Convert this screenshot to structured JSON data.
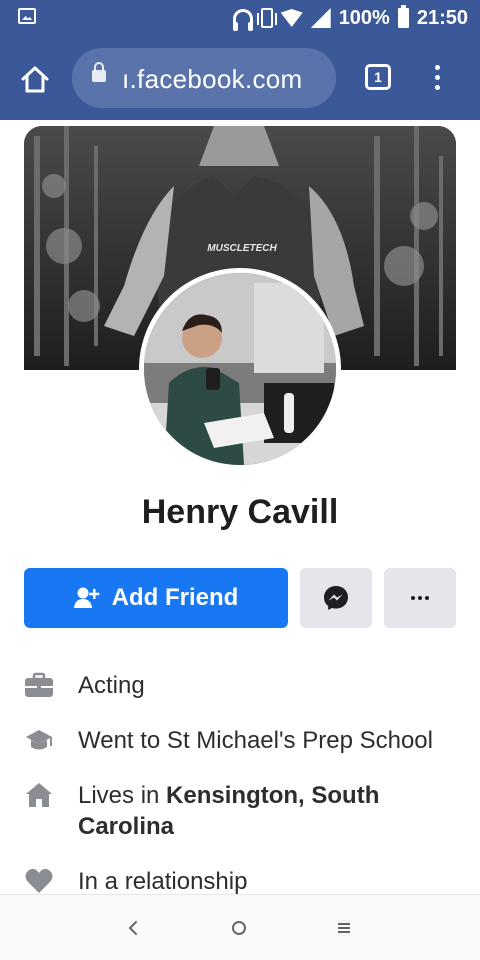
{
  "statusbar": {
    "battery_label": "100%",
    "time": "21:50",
    "icons": [
      "gallery-icon",
      "headphones-icon",
      "vibrate-icon",
      "wifi-icon",
      "signal-icon",
      "battery-icon"
    ]
  },
  "browser": {
    "url": "ı.facebook.com",
    "tab_count": "1",
    "icons": [
      "home-icon",
      "lock-icon",
      "tabs-icon",
      "more-vert-icon"
    ]
  },
  "profile": {
    "name": "Henry Cavill"
  },
  "actions": {
    "add_friend_label": "Add Friend",
    "messenger_icon": "messenger-icon",
    "more_icon": "more-horizontal-icon"
  },
  "intro": {
    "work": "Acting",
    "education": "Went to St Michael's Prep School",
    "lives_prefix": "Lives in ",
    "lives_place": "Kensington, South Carolina",
    "relationship": "In a relationship"
  },
  "navigation": {
    "icons": [
      "back-icon",
      "home-circle-icon",
      "recents-icon"
    ]
  },
  "colors": {
    "bar": "#3b5998",
    "accent": "#1877f2",
    "secondary_button": "#e4e6eb"
  }
}
